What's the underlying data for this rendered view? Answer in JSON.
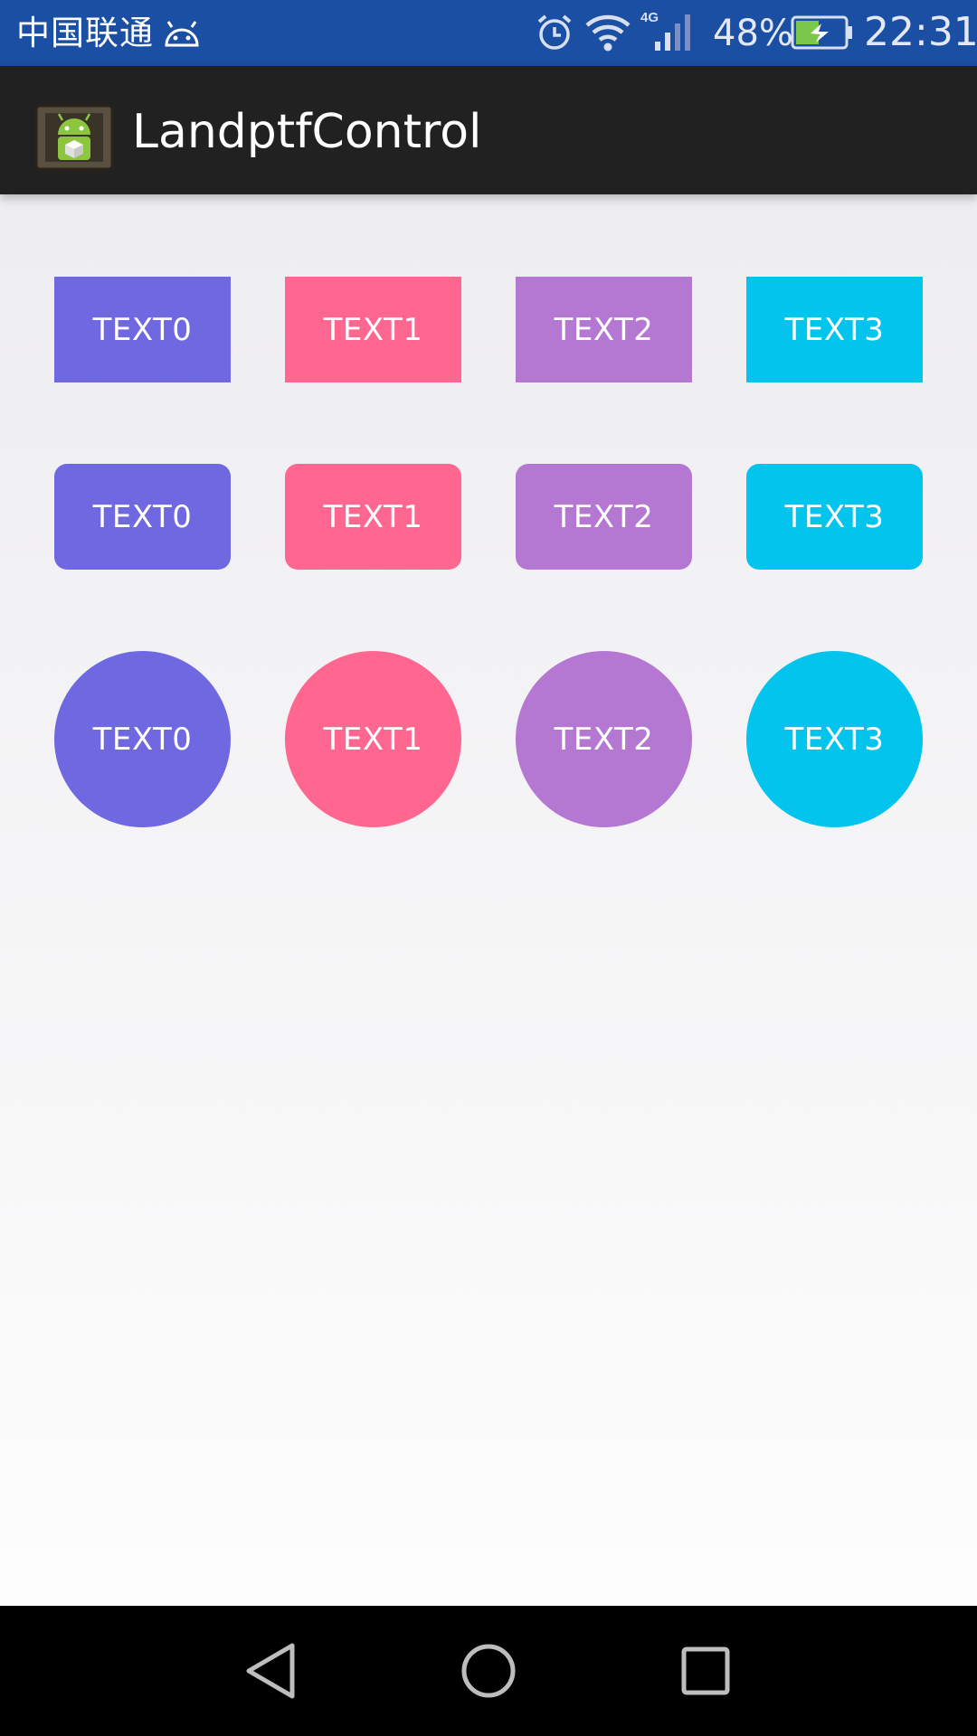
{
  "status_bar": {
    "carrier": "中国联通",
    "battery_percent": "48%",
    "battery_level": 0.48,
    "time": "22:31",
    "network_type": "4G",
    "icons": [
      "android-debug-icon",
      "alarm-icon",
      "wifi-icon",
      "signal-icon",
      "battery-charging-icon"
    ]
  },
  "action_bar": {
    "title": "LandptfControl",
    "icon": "android-app-icon"
  },
  "grid": {
    "rows": [
      {
        "shape": "rectangle",
        "items": [
          "TEXT0",
          "TEXT1",
          "TEXT2",
          "TEXT3"
        ]
      },
      {
        "shape": "rounded-rectangle",
        "items": [
          "TEXT0",
          "TEXT1",
          "TEXT2",
          "TEXT3"
        ]
      },
      {
        "shape": "circle",
        "items": [
          "TEXT0",
          "TEXT1",
          "TEXT2",
          "TEXT3"
        ]
      }
    ],
    "colors": [
      "#7068e0",
      "#ff6690",
      "#b478d3",
      "#03c4ec"
    ]
  },
  "nav_bar": {
    "icons": [
      "back-icon",
      "home-icon",
      "recents-icon"
    ]
  }
}
